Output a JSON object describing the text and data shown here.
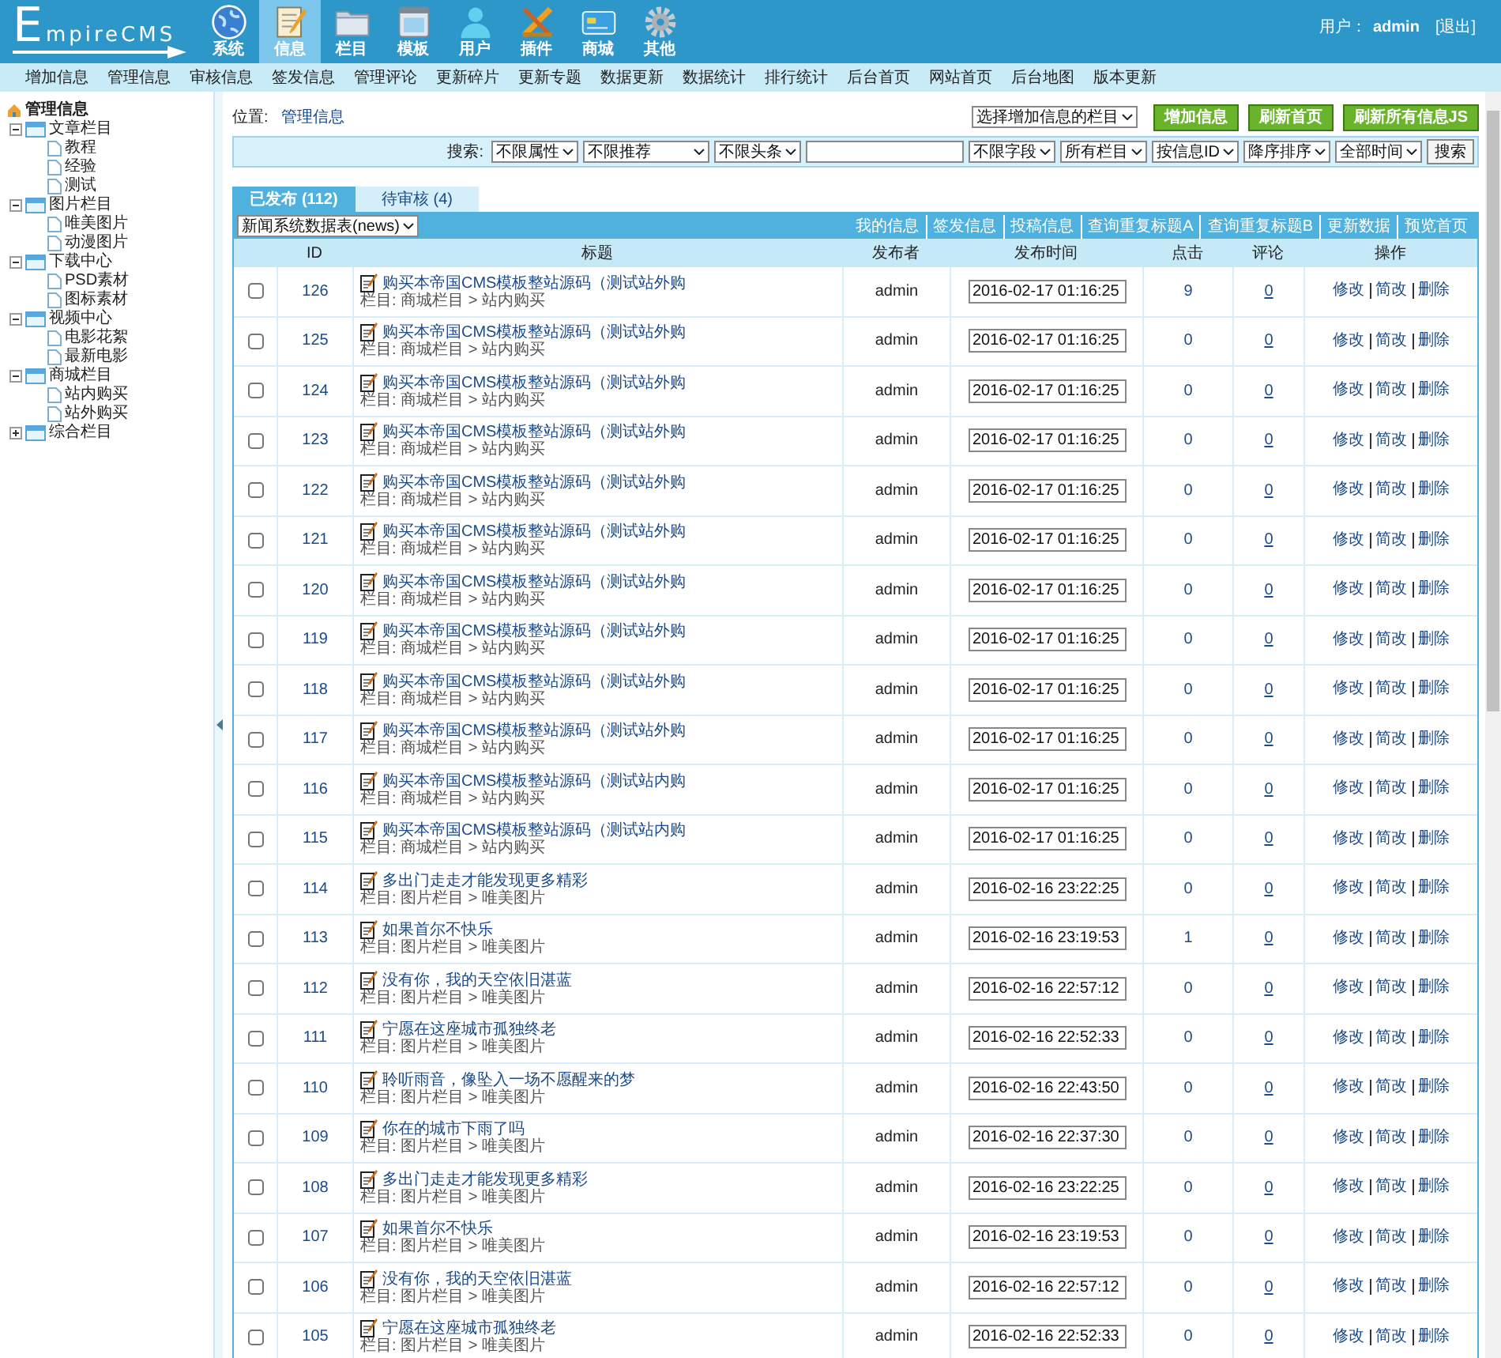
{
  "header": {
    "logo": "EmpireCMS",
    "nav": [
      {
        "label": "系统",
        "selected": false
      },
      {
        "label": "信息",
        "selected": true
      },
      {
        "label": "栏目",
        "selected": false
      },
      {
        "label": "模板",
        "selected": false
      },
      {
        "label": "用户",
        "selected": false
      },
      {
        "label": "插件",
        "selected": false
      },
      {
        "label": "商城",
        "selected": false
      },
      {
        "label": "其他",
        "selected": false
      }
    ],
    "user_label": "用户：",
    "user": "admin",
    "logout": "[退出]"
  },
  "submenu": [
    "增加信息",
    "管理信息",
    "审核信息",
    "签发信息",
    "管理评论",
    "更新碎片",
    "更新专题",
    "数据更新",
    "数据统计",
    "排行统计",
    "后台首页",
    "网站首页",
    "后台地图",
    "版本更新"
  ],
  "sidebar": {
    "title": "管理信息",
    "tree": [
      {
        "label": "文章栏目",
        "expanded": true,
        "children": [
          {
            "label": "教程"
          },
          {
            "label": "经验"
          },
          {
            "label": "测试"
          }
        ]
      },
      {
        "label": "图片栏目",
        "expanded": true,
        "children": [
          {
            "label": "唯美图片"
          },
          {
            "label": "动漫图片"
          }
        ]
      },
      {
        "label": "下载中心",
        "expanded": true,
        "children": [
          {
            "label": "PSD素材"
          },
          {
            "label": "图标素材"
          }
        ]
      },
      {
        "label": "视频中心",
        "expanded": true,
        "children": [
          {
            "label": "电影花絮"
          },
          {
            "label": "最新电影"
          }
        ]
      },
      {
        "label": "商城栏目",
        "expanded": true,
        "children": [
          {
            "label": "站内购买"
          },
          {
            "label": "站外购买"
          }
        ]
      },
      {
        "label": "综合栏目",
        "expanded": false
      }
    ]
  },
  "location": {
    "label": "位置:",
    "link": "管理信息"
  },
  "toolbar": {
    "column_select": "选择增加信息的栏目",
    "buttons": [
      "增加信息",
      "刷新首页",
      "刷新所有信息JS"
    ]
  },
  "search": {
    "label": "搜索:",
    "selects_before": [
      "不限属性",
      "不限推荐",
      "不限头条"
    ],
    "selects_after": [
      "不限字段",
      "所有栏目",
      "按信息ID",
      "降序排序",
      "全部时间"
    ],
    "button": "搜索"
  },
  "tabs": [
    {
      "label": "已发布 (112)",
      "selected": true
    },
    {
      "label": "待审核 (4)",
      "selected": false
    }
  ],
  "table": {
    "table_select": "新闻系统数据表(news)",
    "links": [
      "我的信息",
      "签发信息",
      "投稿信息",
      "查询重复标题A",
      "查询重复标题B",
      "更新数据",
      "预览首页"
    ],
    "columns": [
      "ID",
      "标题",
      "发布者",
      "发布时间",
      "点击",
      "评论",
      "操作"
    ],
    "rows": [
      {
        "checked": false,
        "id": "126",
        "title": "购买本帝国CMS模板整站源码（测试站外购",
        "category": "栏目: 商城栏目 > 站内购买",
        "author": "admin",
        "time": "2016-02-17 01:16:25",
        "clicks": "9",
        "comments": "0",
        "actions": [
          "修改",
          "简改",
          "删除"
        ]
      },
      {
        "checked": false,
        "id": "125",
        "title": "购买本帝国CMS模板整站源码（测试站外购",
        "category": "栏目: 商城栏目 > 站内购买",
        "author": "admin",
        "time": "2016-02-17 01:16:25",
        "clicks": "0",
        "comments": "0",
        "actions": [
          "修改",
          "简改",
          "删除"
        ]
      },
      {
        "checked": false,
        "id": "124",
        "title": "购买本帝国CMS模板整站源码（测试站外购",
        "category": "栏目: 商城栏目 > 站内购买",
        "author": "admin",
        "time": "2016-02-17 01:16:25",
        "clicks": "0",
        "comments": "0",
        "actions": [
          "修改",
          "简改",
          "删除"
        ]
      },
      {
        "checked": false,
        "id": "123",
        "title": "购买本帝国CMS模板整站源码（测试站外购",
        "category": "栏目: 商城栏目 > 站内购买",
        "author": "admin",
        "time": "2016-02-17 01:16:25",
        "clicks": "0",
        "comments": "0",
        "actions": [
          "修改",
          "简改",
          "删除"
        ]
      },
      {
        "checked": false,
        "id": "122",
        "title": "购买本帝国CMS模板整站源码（测试站外购",
        "category": "栏目: 商城栏目 > 站内购买",
        "author": "admin",
        "time": "2016-02-17 01:16:25",
        "clicks": "0",
        "comments": "0",
        "actions": [
          "修改",
          "简改",
          "删除"
        ]
      },
      {
        "checked": false,
        "id": "121",
        "title": "购买本帝国CMS模板整站源码（测试站外购",
        "category": "栏目: 商城栏目 > 站内购买",
        "author": "admin",
        "time": "2016-02-17 01:16:25",
        "clicks": "0",
        "comments": "0",
        "actions": [
          "修改",
          "简改",
          "删除"
        ]
      },
      {
        "checked": false,
        "id": "120",
        "title": "购买本帝国CMS模板整站源码（测试站外购",
        "category": "栏目: 商城栏目 > 站内购买",
        "author": "admin",
        "time": "2016-02-17 01:16:25",
        "clicks": "0",
        "comments": "0",
        "actions": [
          "修改",
          "简改",
          "删除"
        ]
      },
      {
        "checked": false,
        "id": "119",
        "title": "购买本帝国CMS模板整站源码（测试站外购",
        "category": "栏目: 商城栏目 > 站内购买",
        "author": "admin",
        "time": "2016-02-17 01:16:25",
        "clicks": "0",
        "comments": "0",
        "actions": [
          "修改",
          "简改",
          "删除"
        ]
      },
      {
        "checked": false,
        "id": "118",
        "title": "购买本帝国CMS模板整站源码（测试站外购",
        "category": "栏目: 商城栏目 > 站内购买",
        "author": "admin",
        "time": "2016-02-17 01:16:25",
        "clicks": "0",
        "comments": "0",
        "actions": [
          "修改",
          "简改",
          "删除"
        ]
      },
      {
        "checked": false,
        "id": "117",
        "title": "购买本帝国CMS模板整站源码（测试站外购",
        "category": "栏目: 商城栏目 > 站内购买",
        "author": "admin",
        "time": "2016-02-17 01:16:25",
        "clicks": "0",
        "comments": "0",
        "actions": [
          "修改",
          "简改",
          "删除"
        ]
      },
      {
        "checked": false,
        "id": "116",
        "title": "购买本帝国CMS模板整站源码（测试站内购",
        "category": "栏目: 商城栏目 > 站内购买",
        "author": "admin",
        "time": "2016-02-17 01:16:25",
        "clicks": "0",
        "comments": "0",
        "actions": [
          "修改",
          "简改",
          "删除"
        ]
      },
      {
        "checked": false,
        "id": "115",
        "title": "购买本帝国CMS模板整站源码（测试站内购",
        "category": "栏目: 商城栏目 > 站内购买",
        "author": "admin",
        "time": "2016-02-17 01:16:25",
        "clicks": "0",
        "comments": "0",
        "actions": [
          "修改",
          "简改",
          "删除"
        ]
      },
      {
        "checked": false,
        "id": "114",
        "title": "多出门走走才能发现更多精彩",
        "category": "栏目: 图片栏目 > 唯美图片",
        "author": "admin",
        "time": "2016-02-16 23:22:25",
        "clicks": "0",
        "comments": "0",
        "actions": [
          "修改",
          "简改",
          "删除"
        ]
      },
      {
        "checked": false,
        "id": "113",
        "title": "如果首尔不快乐",
        "category": "栏目: 图片栏目 > 唯美图片",
        "author": "admin",
        "time": "2016-02-16 23:19:53",
        "clicks": "1",
        "comments": "0",
        "actions": [
          "修改",
          "简改",
          "删除"
        ]
      },
      {
        "checked": false,
        "id": "112",
        "title": "没有你，我的天空依旧湛蓝",
        "category": "栏目: 图片栏目 > 唯美图片",
        "author": "admin",
        "time": "2016-02-16 22:57:12",
        "clicks": "0",
        "comments": "0",
        "actions": [
          "修改",
          "简改",
          "删除"
        ]
      },
      {
        "checked": false,
        "id": "111",
        "title": "宁愿在这座城市孤独终老",
        "category": "栏目: 图片栏目 > 唯美图片",
        "author": "admin",
        "time": "2016-02-16 22:52:33",
        "clicks": "0",
        "comments": "0",
        "actions": [
          "修改",
          "简改",
          "删除"
        ]
      },
      {
        "checked": false,
        "id": "110",
        "title": "聆听雨音，像坠入一场不愿醒来的梦",
        "category": "栏目: 图片栏目 > 唯美图片",
        "author": "admin",
        "time": "2016-02-16 22:43:50",
        "clicks": "0",
        "comments": "0",
        "actions": [
          "修改",
          "简改",
          "删除"
        ]
      },
      {
        "checked": false,
        "id": "109",
        "title": "你在的城市下雨了吗",
        "category": "栏目: 图片栏目 > 唯美图片",
        "author": "admin",
        "time": "2016-02-16 22:37:30",
        "clicks": "0",
        "comments": "0",
        "actions": [
          "修改",
          "简改",
          "删除"
        ]
      },
      {
        "checked": false,
        "id": "108",
        "title": "多出门走走才能发现更多精彩",
        "category": "栏目: 图片栏目 > 唯美图片",
        "author": "admin",
        "time": "2016-02-16 23:22:25",
        "clicks": "0",
        "comments": "0",
        "actions": [
          "修改",
          "简改",
          "删除"
        ]
      },
      {
        "checked": false,
        "id": "107",
        "title": "如果首尔不快乐",
        "category": "栏目: 图片栏目 > 唯美图片",
        "author": "admin",
        "time": "2016-02-16 23:19:53",
        "clicks": "0",
        "comments": "0",
        "actions": [
          "修改",
          "简改",
          "删除"
        ]
      },
      {
        "checked": false,
        "id": "106",
        "title": "没有你，我的天空依旧湛蓝",
        "category": "栏目: 图片栏目 > 唯美图片",
        "author": "admin",
        "time": "2016-02-16 22:57:12",
        "clicks": "0",
        "comments": "0",
        "actions": [
          "修改",
          "简改",
          "删除"
        ]
      },
      {
        "checked": false,
        "id": "105",
        "title": "宁愿在这座城市孤独终老",
        "category": "栏目: 图片栏目 > 唯美图片",
        "author": "admin",
        "time": "2016-02-16 22:52:33",
        "clicks": "0",
        "comments": "0",
        "actions": [
          "修改",
          "简改",
          "删除"
        ]
      }
    ]
  }
}
